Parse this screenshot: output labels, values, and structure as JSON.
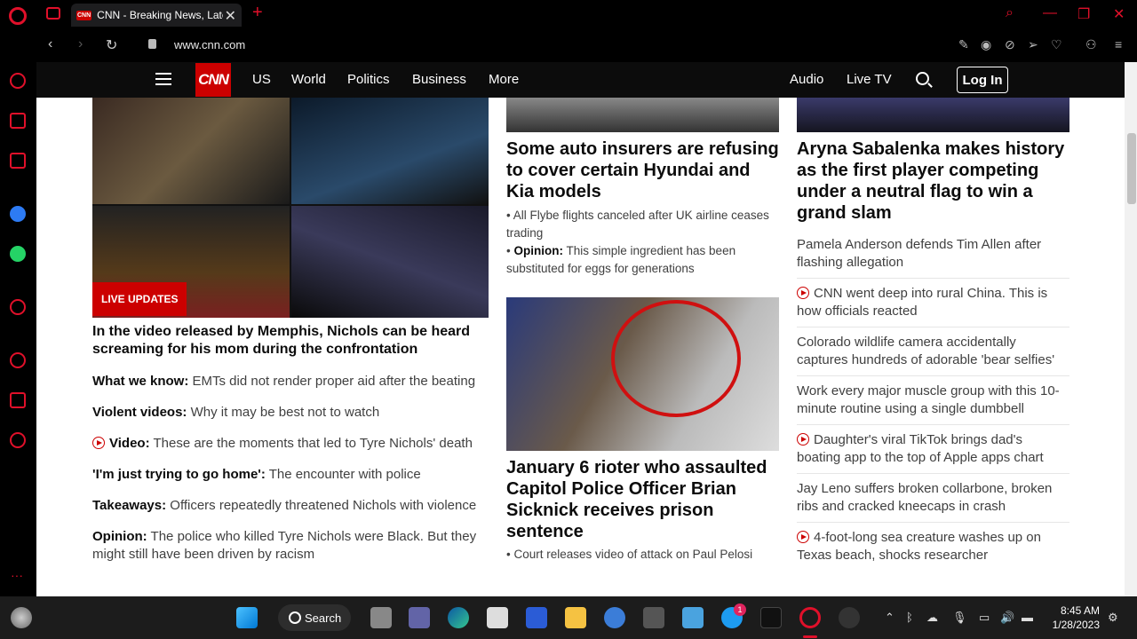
{
  "browser": {
    "tab_title": "CNN - Breaking News, Latest",
    "tab_favicon": "CNN",
    "url": "www.cnn.com"
  },
  "cnn_nav": {
    "logo": "CNN",
    "links": [
      "US",
      "World",
      "Politics",
      "Business",
      "More"
    ],
    "right_links": [
      "Audio",
      "Live TV"
    ],
    "login": "Log In"
  },
  "left_col": {
    "badge": "LIVE UPDATES",
    "headline": "In the video released by Memphis, Nichols can be heard screaming for his mom during the confrontation",
    "stories": [
      {
        "label": "What we know:",
        "text": " EMTs did not render proper aid after the beating",
        "video": false
      },
      {
        "label": "Violent videos:",
        "text": " Why it may be best not to watch",
        "video": false
      },
      {
        "label": "Video:",
        "text": " These are the moments that led to Tyre Nichols' death",
        "video": true
      },
      {
        "label": "'I'm just trying to go home':",
        "text": " The encounter with police",
        "video": false
      },
      {
        "label": "Takeaways:",
        "text": " Officers repeatedly threatened Nichols with violence",
        "video": false
      },
      {
        "label": "Opinion:",
        "text": " The police who killed Tyre Nichols were Black. But they might still have been driven by racism",
        "video": false
      }
    ]
  },
  "mid_col": {
    "headline1": "Some auto insurers are refusing to cover certain Hyundai and Kia models",
    "sub1": "All Flybe flights canceled after UK airline ceases trading",
    "sub2_label": "Opinion:",
    "sub2_text": " This simple ingredient has been substituted for eggs for generations",
    "headline2": "January 6 rioter who assaulted Capitol Police Officer Brian Sicknick receives prison sentence",
    "sub3": "Court releases video of attack on Paul Pelosi"
  },
  "right_col": {
    "headline": "Aryna Sabalenka makes history as the first player competing under a neutral flag to win a grand slam",
    "items": [
      {
        "text": "Pamela Anderson defends Tim Allen after flashing allegation",
        "video": false
      },
      {
        "text": "CNN went deep into rural China. This is how officials reacted",
        "video": true
      },
      {
        "text": "Colorado wildlife camera accidentally captures hundreds of adorable 'bear selfies'",
        "video": false
      },
      {
        "text": "Work every major muscle group with this 10-minute routine using a single dumbbell",
        "video": false
      },
      {
        "text": "Daughter's viral TikTok brings dad's boating app to the top of Apple apps chart",
        "video": true
      },
      {
        "text": "Jay Leno suffers broken collarbone, broken ribs and cracked kneecaps in crash",
        "video": false
      },
      {
        "text": "4-foot-long sea creature washes up on Texas beach, shocks researcher",
        "video": true
      }
    ]
  },
  "taskbar": {
    "search": "Search",
    "time": "8:45 AM",
    "date": "1/28/2023",
    "twitter_badge": "1"
  }
}
